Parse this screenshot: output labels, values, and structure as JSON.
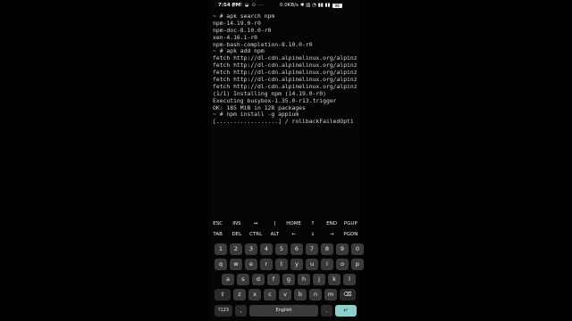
{
  "status_bar": {
    "time": "7:54 PM",
    "icons_left": "◎ ✆ ◒ ⊙ ···",
    "net_speed": "0.0KB/s",
    "icons_right": "✱ ▥ ◔ ▮▮ ▮▮",
    "battery": "98"
  },
  "terminal": {
    "lines": [
      "~ # apk search npm",
      "npm-14.19.0-r0",
      "npm-doc-8.10.0-r0",
      "xen-4.16.1-r0",
      "npm-bash-completion-8.10.0-r0",
      "~ # apk add npm",
      "fetch http://dl-cdn.alpinelinux.org/alpinz",
      "fetch http://dl-cdn.alpinelinux.org/alpinz",
      "fetch http://dl-cdn.alpinelinux.org/alpinz",
      "fetch http://dl-cdn.alpinelinux.org/alpinz",
      "fetch http://dl-cdn.alpinelinux.org/alpinz",
      "(1/1) Installing npm (14.19.0-r0)",
      "Executing busybox-1.35.0-r13.trigger",
      "OK: 185 MiB in 128 packages",
      "~ # npm install -g appium",
      "[..................] / rollbackFailedOpti"
    ]
  },
  "extra_keys": {
    "row1": [
      "ESC",
      "INS",
      "↔",
      "|",
      "HOME",
      "↑",
      "END",
      "PGUP"
    ],
    "row2": [
      "TAB",
      "DEL",
      "CTRL",
      "ALT",
      "←",
      "↓",
      "→",
      "PGDN"
    ]
  },
  "keyboard": {
    "numbers": [
      "1",
      "2",
      "3",
      "4",
      "5",
      "6",
      "7",
      "8",
      "9",
      "0"
    ],
    "row_q": [
      "q",
      "w",
      "e",
      "r",
      "t",
      "y",
      "u",
      "i",
      "o",
      "p"
    ],
    "row_a": [
      "a",
      "s",
      "d",
      "f",
      "g",
      "h",
      "j",
      "k",
      "l"
    ],
    "row_z": [
      "z",
      "x",
      "c",
      "v",
      "b",
      "n",
      "m"
    ],
    "shift": "⇧",
    "backspace": "⌫",
    "symbols": "?123",
    "comma": ",",
    "space": "English",
    "period": ".",
    "enter": "↵"
  }
}
